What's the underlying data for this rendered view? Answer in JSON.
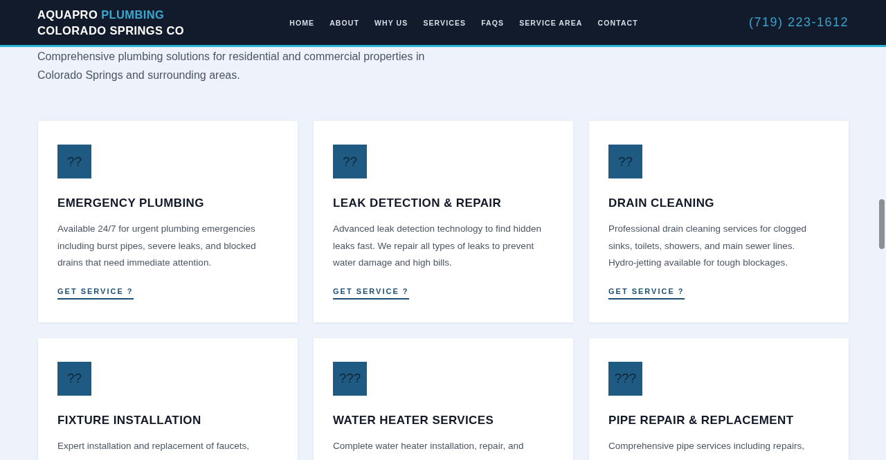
{
  "header": {
    "logo": {
      "brand": "AQUAPRO",
      "brand_accent": "PLUMBING",
      "tagline": "COLORADO SPRINGS CO"
    },
    "nav": [
      "HOME",
      "ABOUT",
      "WHY US",
      "SERVICES",
      "FAQS",
      "SERVICE AREA",
      "CONTACT"
    ],
    "phone": "(719) 223-1612"
  },
  "intro": "Comprehensive plumbing solutions for residential and commercial properties in Colorado Springs and surrounding areas.",
  "services": [
    {
      "icon": "??",
      "title": "EMERGENCY PLUMBING",
      "description": "Available 24/7 for urgent plumbing emergencies including burst pipes, severe leaks, and blocked drains that need immediate attention.",
      "link": "GET SERVICE ?"
    },
    {
      "icon": "??",
      "title": "LEAK DETECTION & REPAIR",
      "description": "Advanced leak detection technology to find hidden leaks fast. We repair all types of leaks to prevent water damage and high bills.",
      "link": "GET SERVICE ?"
    },
    {
      "icon": "??",
      "title": "DRAIN CLEANING",
      "description": "Professional drain cleaning services for clogged sinks, toilets, showers, and main sewer lines. Hydro-jetting available for tough blockages.",
      "link": "GET SERVICE ?"
    },
    {
      "icon": "??",
      "title": "FIXTURE INSTALLATION",
      "description": "Expert installation and replacement of faucets,"
    },
    {
      "icon": "???",
      "title": "WATER HEATER SERVICES",
      "description": "Complete water heater installation, repair, and"
    },
    {
      "icon": "???",
      "title": "PIPE REPAIR & REPLACEMENT",
      "description": "Comprehensive pipe services including repairs,"
    }
  ]
}
